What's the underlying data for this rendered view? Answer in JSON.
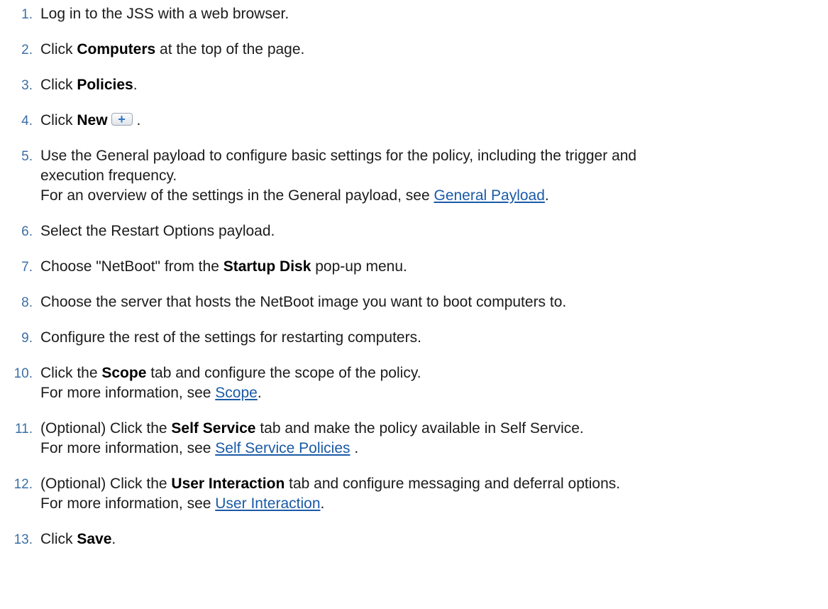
{
  "steps": [
    {
      "num": "1.",
      "text": "Log in to the JSS with a web browser."
    },
    {
      "num": "2.",
      "pre": "Click ",
      "bold": "Computers",
      "post": " at the top of the page."
    },
    {
      "num": "3.",
      "pre": "Click ",
      "bold": "Policies",
      "post": "."
    },
    {
      "num": "4.",
      "pre": "Click ",
      "bold": "New",
      "icon": "+",
      "post": "."
    },
    {
      "num": "5.",
      "line1": "Use the General payload to configure basic settings for the policy, including the trigger and",
      "line2": "execution frequency.",
      "line3_pre": "For an overview of the settings in the General payload, see ",
      "line3_link": "General Payload",
      "line3_post": "."
    },
    {
      "num": "6.",
      "text": "Select the Restart Options payload."
    },
    {
      "num": "7.",
      "pre": "Choose \"NetBoot\" from the ",
      "bold": "Startup Disk",
      "post": " pop-up menu."
    },
    {
      "num": "8.",
      "text": "Choose the server that hosts the NetBoot image you want to boot computers to."
    },
    {
      "num": "9.",
      "text": "Configure the rest of the settings for restarting computers."
    },
    {
      "num": "10.",
      "pre": "Click the ",
      "bold": "Scope",
      "post": " tab and configure the scope of the policy.",
      "line2_pre": "For more information, see ",
      "line2_link": "Scope",
      "line2_post": "."
    },
    {
      "num": "11.",
      "pre": "(Optional) Click the ",
      "bold": "Self Service",
      "post": " tab and make the policy available in Self Service.",
      "line2_pre": "For more information, see ",
      "line2_link": "Self Service Policies",
      "line2_post": " ."
    },
    {
      "num": "12.",
      "pre": "(Optional) Click the ",
      "bold": "User Interaction",
      "post": " tab and configure messaging and deferral options.",
      "line2_pre": "For more information, see ",
      "line2_link": "User Interaction",
      "line2_post": "."
    },
    {
      "num": "13.",
      "pre": "Click ",
      "bold": "Save",
      "post": "."
    }
  ]
}
